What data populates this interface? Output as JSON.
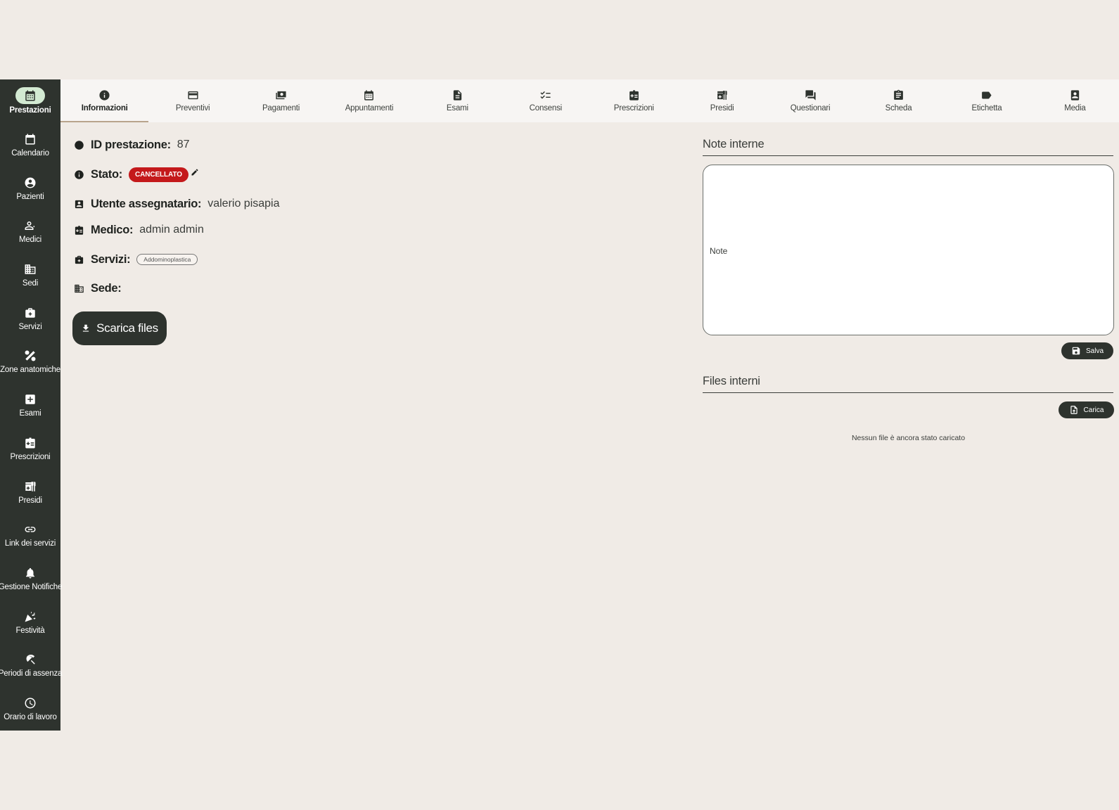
{
  "sidebar": {
    "items": [
      {
        "label": "Prestazioni",
        "icon": "calendar-icon",
        "active": true
      },
      {
        "label": "Calendario",
        "icon": "calendar-blank-icon"
      },
      {
        "label": "Pazienti",
        "icon": "account-circle-icon"
      },
      {
        "label": "Medici",
        "icon": "doctor-icon"
      },
      {
        "label": "Sedi",
        "icon": "building-icon"
      },
      {
        "label": "Servizi",
        "icon": "medical-bag-icon"
      },
      {
        "label": "Zone anatomiche",
        "icon": "body-zones-icon"
      },
      {
        "label": "Esami",
        "icon": "medical-plus-icon"
      },
      {
        "label": "Prescrizioni",
        "icon": "prescription-icon"
      },
      {
        "label": "Presidi",
        "icon": "medical-supplies-icon"
      },
      {
        "label": "Link dei servizi",
        "icon": "link-icon"
      },
      {
        "label": "Gestione Notifiche",
        "icon": "bell-icon"
      },
      {
        "label": "Festività",
        "icon": "party-icon"
      },
      {
        "label": "Periodi di assenza",
        "icon": "beach-umbrella-icon"
      },
      {
        "label": "Orario di lavoro",
        "icon": "clock-icon"
      }
    ]
  },
  "tabs": [
    {
      "label": "Informazioni",
      "icon": "info-icon",
      "active": true
    },
    {
      "label": "Preventivi",
      "icon": "credit-card-icon"
    },
    {
      "label": "Pagamenti",
      "icon": "cash-icon"
    },
    {
      "label": "Appuntamenti",
      "icon": "calendar-icon"
    },
    {
      "label": "Esami",
      "icon": "document-icon"
    },
    {
      "label": "Consensi",
      "icon": "checklist-icon"
    },
    {
      "label": "Prescrizioni",
      "icon": "prescription-icon"
    },
    {
      "label": "Presidi",
      "icon": "medical-supplies-icon"
    },
    {
      "label": "Questionari",
      "icon": "chat-icon"
    },
    {
      "label": "Scheda",
      "icon": "clipboard-icon"
    },
    {
      "label": "Etichetta",
      "icon": "label-icon"
    },
    {
      "label": "Media",
      "icon": "media-icon"
    }
  ],
  "info": {
    "id_label": "ID prestazione:",
    "id_value": "87",
    "stato_label": "Stato:",
    "stato_value": "CANCELLATO",
    "utente_label": "Utente assegnatario:",
    "utente_value": "valerio pisapia",
    "medico_label": "Medico:",
    "medico_value": "admin admin",
    "servizi_label": "Servizi:",
    "servizi_value": "Addominoplastica",
    "sede_label": "Sede:",
    "sede_value": "",
    "download_label": "Scarica files"
  },
  "notes": {
    "title": "Note interne",
    "placeholder": "Note",
    "save_label": "Salva"
  },
  "files": {
    "title": "Files interni",
    "upload_label": "Carica",
    "empty_message": "Nessun file è ancora stato caricato"
  },
  "colors": {
    "sidebar_bg": "#2e332e",
    "page_bg": "#f0ebe6",
    "active_pill": "#d3ead2",
    "status_cancelled": "#c4191b"
  }
}
